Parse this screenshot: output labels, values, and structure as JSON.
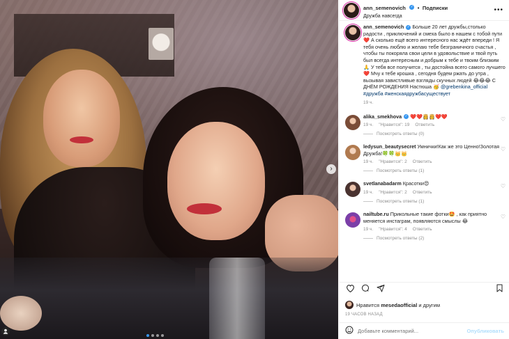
{
  "post": {
    "username": "ann_semenovich",
    "verified": true,
    "follow_label": "Подписки",
    "location": "Дружба навсегда",
    "separator": "•",
    "more_icon": "more-horizontal-icon"
  },
  "photo": {
    "next_arrow": "›",
    "tag_icon": "user-tag-icon",
    "carousel_dots": 4,
    "active_dot": 0
  },
  "caption": {
    "username": "ann_semenovich",
    "text": "Больше 20 лет дружбы,столько радости , приключений и смеха было в нашем с тобой пути ❤️ А сколько ещё всего интересного нас ждёт впереди ! Я тебя очень люблю и желаю тебе безграничного счастья , чтобы ты покоряла свои цели в удовольствие и твой путь был всегда интересным и добрым к тебе и твоим близким 🙏 У тебя все получится , ты достойна всего самого лучшего ❤️ Мчу к тебе крошка , сегодня будем ржать до утра , вызывая завистливые взгляды скучных людей 😂😂😂 С ДНЁМ РОЖДЕНИЯ Настюша 🥳",
    "mention": "@grebenkina_official",
    "hashtags": "#дружба #женскаядружбасуществует",
    "time": "19 ч."
  },
  "comments": [
    {
      "username": "alika_smekhova",
      "verified": true,
      "text": "❤️❤️👸👸❤️❤️",
      "time": "19 ч.",
      "likes": "\"Нравится\": 19",
      "reply": "Ответить",
      "view_replies": "Посмотреть ответы (0)"
    },
    {
      "username": "ledysun_beautysecret",
      "verified": false,
      "text": "Умнички!Как же это Ценно!Золотая Дружба!🍀🍀👑👑",
      "time": "19 ч.",
      "likes": "\"Нравится\": 2",
      "reply": "Ответить",
      "view_replies": "Посмотреть ответы (1)"
    },
    {
      "username": "svetlanabadarm",
      "verified": false,
      "text": "Красотки😍",
      "time": "19 ч.",
      "likes": "\"Нравится\": 2",
      "reply": "Ответить",
      "view_replies": "Посмотреть ответы (1)"
    },
    {
      "username": "nailtube.ru",
      "verified": false,
      "text": "Прикольные такие фотки🤩 , как приятно меняется инстаграм, появляются смыслы 😂",
      "time": "19 ч.",
      "likes": "\"Нравится\": 4",
      "reply": "Ответить",
      "view_replies": "Посмотреть ответы (2)"
    }
  ],
  "actions": {
    "like_icon": "heart-icon",
    "comment_icon": "comment-icon",
    "share_icon": "share-icon",
    "save_icon": "bookmark-icon"
  },
  "likes_line": {
    "prefix": "Нравится",
    "user": "mesedaofficial",
    "suffix": "и другим"
  },
  "timestamp": "19 часов назад",
  "comment_box": {
    "emoji_icon": "emoji-icon",
    "placeholder": "Добавьте комментарий...",
    "publish": "Опубликовать"
  },
  "colors": {
    "link": "#00376b",
    "verified": "#3897f0",
    "muted": "#8e8e8e",
    "publish_disabled": "#b2dffc"
  }
}
